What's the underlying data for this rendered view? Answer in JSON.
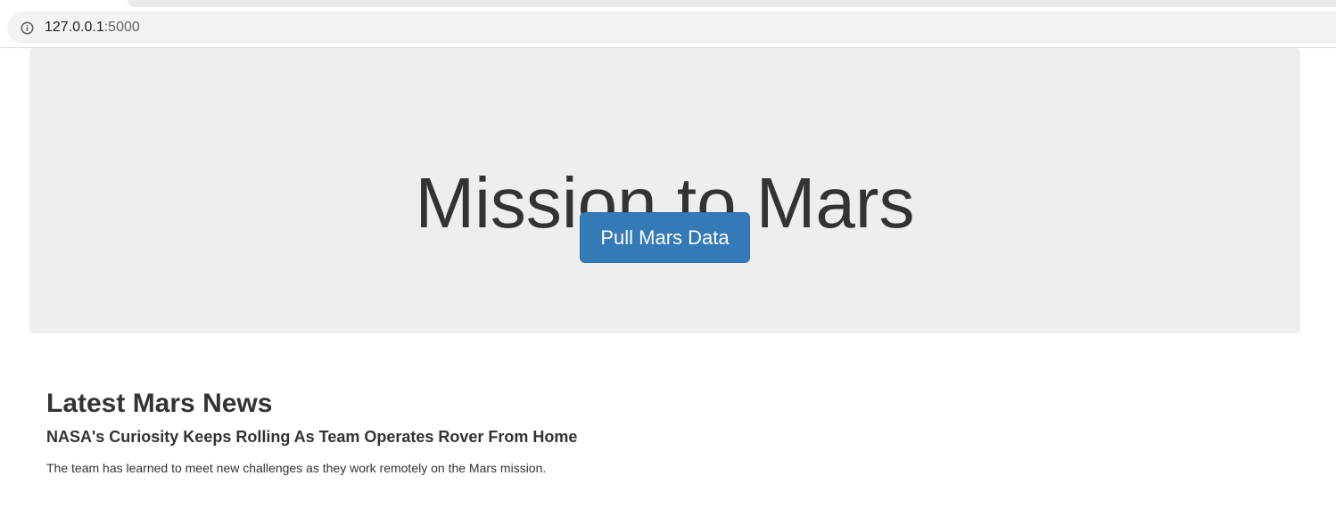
{
  "browser": {
    "url_host": "127.0.0.1",
    "url_port": ":5000",
    "info_icon": "info-icon"
  },
  "jumbotron": {
    "title": "Mission to Mars",
    "button_label": "Pull Mars Data",
    "button_color": "#337ab7",
    "background_color": "#eeeeee"
  },
  "news": {
    "heading": "Latest Mars News",
    "title": "NASA's Curiosity Keeps Rolling As Team Operates Rover From Home",
    "teaser": "The team has learned to meet new challenges as they work remotely on the Mars mission."
  }
}
